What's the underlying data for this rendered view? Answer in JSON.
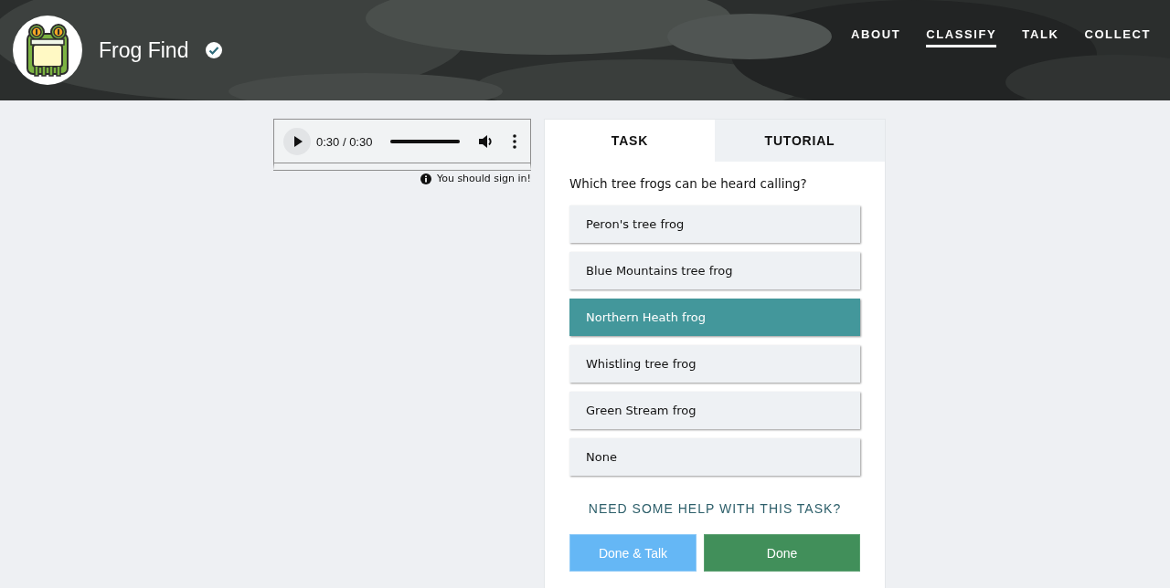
{
  "header": {
    "title": "Frog Find",
    "verified": true,
    "nav": [
      {
        "label": "ABOUT",
        "selected": false
      },
      {
        "label": "CLASSIFY",
        "selected": true
      },
      {
        "label": "TALK",
        "selected": false
      },
      {
        "label": "COLLECT",
        "selected": false
      }
    ]
  },
  "audio": {
    "time": "0:30 / 0:30",
    "level": 1
  },
  "sign_in_note": "You should sign in!",
  "tabs": [
    {
      "label": "TASK",
      "selected": true
    },
    {
      "label": "TUTORIAL",
      "selected": false
    }
  ],
  "question": "Which tree frogs can be heard calling?",
  "answers": [
    {
      "label": "Peron's tree frog",
      "selected": false
    },
    {
      "label": "Blue Mountains tree frog",
      "selected": false
    },
    {
      "label": "Northern Heath frog",
      "selected": true
    },
    {
      "label": "Whistling tree frog",
      "selected": false
    },
    {
      "label": "Green Stream frog",
      "selected": false
    },
    {
      "label": "None",
      "selected": false
    }
  ],
  "help_link": "NEED SOME HELP WITH THIS TASK?",
  "buttons": [
    {
      "label": "Done & Talk",
      "kind": "secondary"
    },
    {
      "label": "Done",
      "kind": "primary"
    }
  ]
}
